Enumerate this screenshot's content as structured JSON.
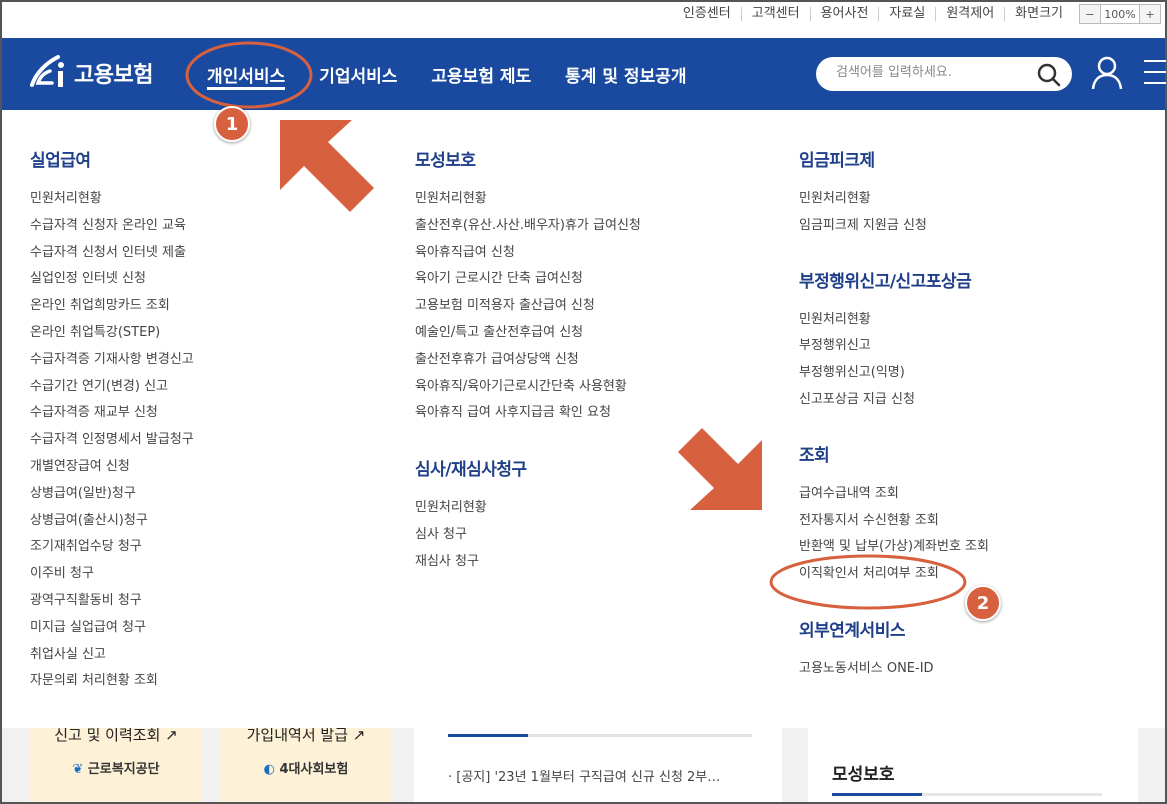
{
  "util": {
    "links": [
      "인증센터",
      "고객센터",
      "용어사전",
      "자료실",
      "원격제어",
      "화면크기"
    ],
    "zoom_minus": "−",
    "zoom_value": "100%",
    "zoom_plus": "+"
  },
  "nav": {
    "logo": "고용보험",
    "items": [
      "개인서비스",
      "기업서비스",
      "고용보험 제도",
      "통계 및 정보공개"
    ],
    "search_placeholder": "검색어를 입력하세요."
  },
  "mega": {
    "col1": {
      "groups": [
        {
          "title": "실업급여",
          "links": [
            "민원처리현황",
            "수급자격 신청자 온라인 교육",
            "수급자격 신청서 인터넷 제출",
            "실업인정 인터넷 신청",
            "온라인 취업희망카드 조회",
            "온라인 취업특강(STEP)",
            "수급자격증 기재사항 변경신고",
            "수급기간 연기(변경) 신고",
            "수급자격증 재교부 신청",
            "수급자격 인정명세서 발급청구",
            "개별연장급여 신청",
            "상병급여(일반)청구",
            "상병급여(출산시)청구",
            "조기재취업수당 청구",
            "이주비 청구",
            "광역구직활동비 청구",
            "미지급 실업급여 청구",
            "취업사실 신고",
            "자문의뢰 처리현황 조회"
          ]
        }
      ]
    },
    "col2": {
      "groups": [
        {
          "title": "모성보호",
          "links": [
            "민원처리현황",
            "출산전후(유산.사산.배우자)휴가 급여신청",
            "육아휴직급여 신청",
            "육아기 근로시간 단축 급여신청",
            "고용보험 미적용자 출산급여 신청",
            "예술인/특고 출산전후급여 신청",
            "출산전후휴가 급여상당액 신청",
            "육아휴직/육아기근로시간단축 사용현황",
            "육아휴직 급여 사후지급금 확인 요청"
          ]
        },
        {
          "title": "심사/재심사청구",
          "links": [
            "민원처리현황",
            "심사 청구",
            "재심사 청구"
          ]
        }
      ]
    },
    "col3": {
      "groups": [
        {
          "title": "임금피크제",
          "links": [
            "민원처리현황",
            "임금피크제 지원금 신청"
          ]
        },
        {
          "title": "부정행위신고/신고포상금",
          "links": [
            "민원처리현황",
            "부정행위신고",
            "부정행위신고(익명)",
            "신고포상금 지급 신청"
          ]
        },
        {
          "title": "조회",
          "links": [
            "급여수급내역 조회",
            "전자통지서 수신현황 조회",
            "반환액 및 납부(가상)계좌번호 조회",
            "이직확인서 처리여부 조회"
          ]
        },
        {
          "title": "외부연계서비스",
          "links": [
            "고용노동서비스 ONE-ID"
          ]
        }
      ]
    }
  },
  "bottom": {
    "card1_title": "신고 및 이력조회",
    "card1_brand": "근로복지공단",
    "card2_title": "가입내역서 발급",
    "card2_brand": "4대사회보험",
    "news_text": "[공지] '23년 1월부터 구직급여 신규 신청 2부…",
    "panel_title": "모성보호"
  },
  "annotations": {
    "badge1": "1",
    "badge2": "2"
  },
  "colors": {
    "nav_bg": "#1a4aa0",
    "category_text": "#1f3f8a",
    "annotation": "#d7603f",
    "card_bg": "#fdf1d7"
  }
}
